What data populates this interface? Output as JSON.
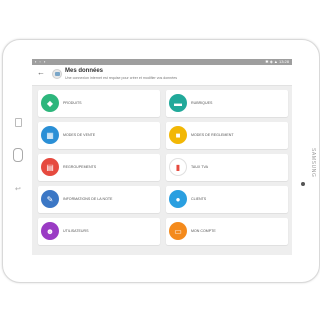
{
  "device": {
    "brand": "SAMSUNG"
  },
  "statusbar": {
    "left": "▪ ▫ ▪",
    "right": "✱ ◈ ▲ 13:28"
  },
  "header": {
    "title": "Mes données",
    "subtitle": "Une connexion internet est requise pour créer et modifier vos données"
  },
  "tiles": [
    {
      "label": "PRODUITS",
      "icon": "tag-icon",
      "color": "#2db67c",
      "glyph": "◆"
    },
    {
      "label": "RUBRIQUES",
      "icon": "folder-icon",
      "color": "#21a99a",
      "glyph": "▬"
    },
    {
      "label": "MODES DE VENTE",
      "icon": "shop-icon",
      "color": "#2a8fd6",
      "glyph": "▦"
    },
    {
      "label": "MODES DE REGLEMENT",
      "icon": "wallet-icon",
      "color": "#f2b705",
      "glyph": "■"
    },
    {
      "label": "REGROUPEMENTS",
      "icon": "documents-icon",
      "color": "#e64a3f",
      "glyph": "▤"
    },
    {
      "label": "TAUX TVA",
      "icon": "bar-chart-icon",
      "color": "#ffffff",
      "glyph": "▮"
    },
    {
      "label": "INFORMATIONS DE LA NOTE",
      "icon": "pencil-icon",
      "color": "#3b77c5",
      "glyph": "✎"
    },
    {
      "label": "CLIENTS",
      "icon": "user-icon",
      "color": "#2a9fe0",
      "glyph": "●"
    },
    {
      "label": "UTILISATEURS",
      "icon": "masks-icon",
      "color": "#9a3bc4",
      "glyph": "☻"
    },
    {
      "label": "MON COMPTE",
      "icon": "id-card-icon",
      "color": "#f48a1c",
      "glyph": "▭"
    }
  ]
}
